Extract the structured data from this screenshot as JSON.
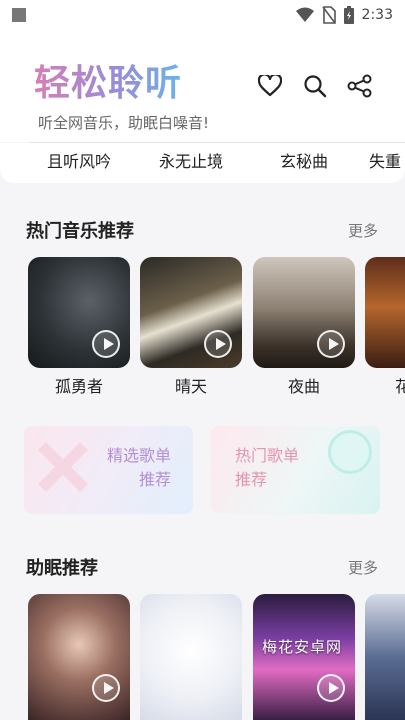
{
  "status_bar": {
    "time": "2:33",
    "icons": [
      "wifi-icon",
      "no-sim-icon",
      "battery-icon"
    ]
  },
  "header": {
    "title": "轻松聆听",
    "subtitle": "听全网音乐，助眠白噪音!",
    "actions": [
      "favorite-icon",
      "search-icon",
      "share-icon"
    ]
  },
  "tags": [
    "且听风吟",
    "永无止境",
    "玄秘曲",
    "失重"
  ],
  "hot_music": {
    "title": "热门音乐推荐",
    "more": "更多",
    "items": [
      {
        "label": "孤勇者"
      },
      {
        "label": "晴天"
      },
      {
        "label": "夜曲"
      },
      {
        "label": "花"
      }
    ]
  },
  "playlists": [
    {
      "line1": "精选歌单",
      "line2": "推荐"
    },
    {
      "line1": "热门歌单",
      "line2": "推荐"
    }
  ],
  "sleep": {
    "title": "助眠推荐",
    "more": "更多"
  },
  "watermark": "梅花安卓网",
  "colors": {
    "title_gradient_start": "#d57fb5",
    "title_gradient_end": "#6ab4e6",
    "background": "#f5f5f7"
  }
}
